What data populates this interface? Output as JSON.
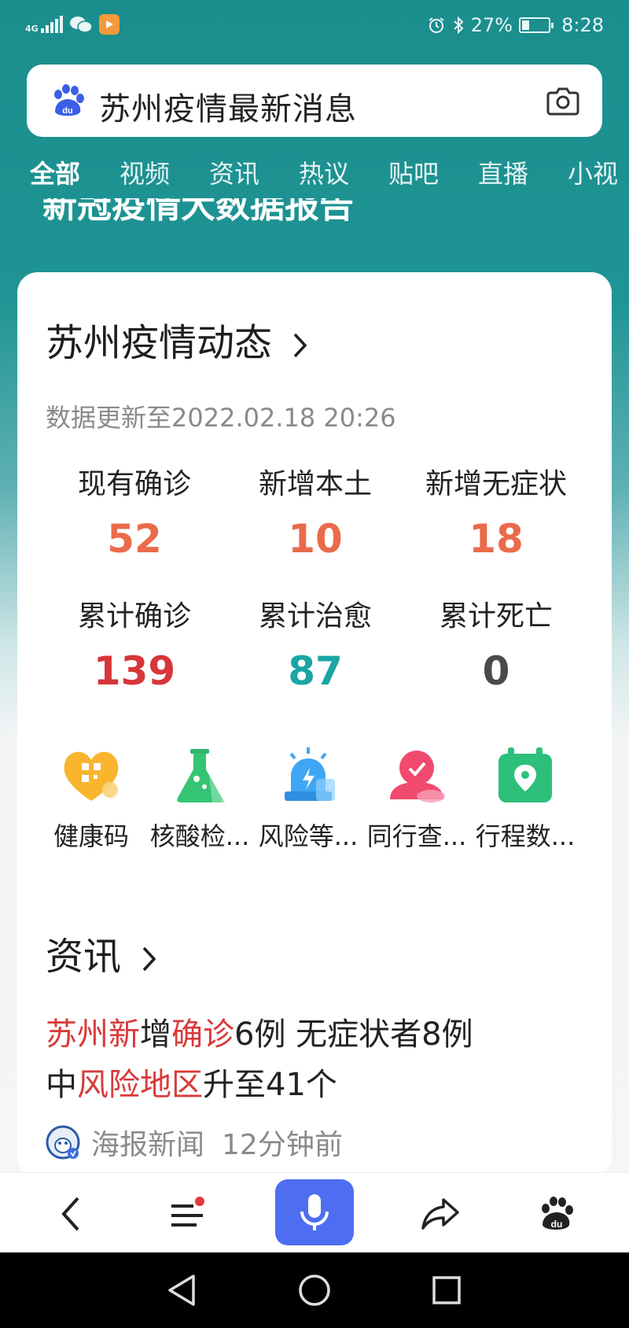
{
  "status_bar": {
    "network": "4G",
    "battery": "27%",
    "battery_level": 0.27,
    "time": "8:28",
    "icons": [
      "signal-icon",
      "wechat-icon",
      "video-app-icon",
      "alarm-icon",
      "bluetooth-icon",
      "battery-icon"
    ]
  },
  "search": {
    "query": "苏州疫情最新消息",
    "logo": "baidu-paw-icon",
    "camera": "camera-icon"
  },
  "tabs": [
    {
      "label": "全部",
      "active": true
    },
    {
      "label": "视频",
      "active": false
    },
    {
      "label": "资讯",
      "active": false
    },
    {
      "label": "热议",
      "active": false
    },
    {
      "label": "贴吧",
      "active": false
    },
    {
      "label": "直播",
      "active": false
    },
    {
      "label": "小视",
      "active": false
    }
  ],
  "banner": {
    "text": "新冠疫情大数据报告"
  },
  "card": {
    "title": "苏州疫情动态",
    "update": "数据更新至2022.02.18 20:26",
    "stats": [
      {
        "label": "现有确诊",
        "value": "52",
        "color": "#ea6b4b"
      },
      {
        "label": "新增本土",
        "value": "10",
        "color": "#ea6b4b"
      },
      {
        "label": "新增无症状",
        "value": "18",
        "color": "#ea6b4b"
      },
      {
        "label": "累计确诊",
        "value": "139",
        "color": "#d6363a"
      },
      {
        "label": "累计治愈",
        "value": "87",
        "color": "#1ba5a5"
      },
      {
        "label": "累计死亡",
        "value": "0",
        "color": "#4a4a4a"
      }
    ],
    "tools": [
      {
        "label": "健康码",
        "icon": "health-code-heart-icon"
      },
      {
        "label": "核酸检...",
        "icon": "flask-icon"
      },
      {
        "label": "风险等...",
        "icon": "alarm-light-icon"
      },
      {
        "label": "同行查...",
        "icon": "person-check-icon"
      },
      {
        "label": "行程数...",
        "icon": "location-calendar-icon"
      }
    ]
  },
  "news": {
    "heading": "资讯",
    "line1": {
      "seg1": "苏州新",
      "seg2": "增",
      "seg3": "确诊",
      "seg4": "6例 无症状者8例"
    },
    "line2": {
      "seg1": "中",
      "seg2": "风险地区",
      "seg3": "升至41个"
    },
    "source": "海报新闻",
    "time": "12分钟前"
  },
  "toolbar": {
    "icons": [
      "back-arrow-icon",
      "menu-icon",
      "microphone-icon",
      "share-icon",
      "baidu-paw-icon"
    ]
  },
  "navbar": {
    "icons": [
      "nav-back-icon",
      "nav-home-icon",
      "nav-recent-icon"
    ]
  }
}
